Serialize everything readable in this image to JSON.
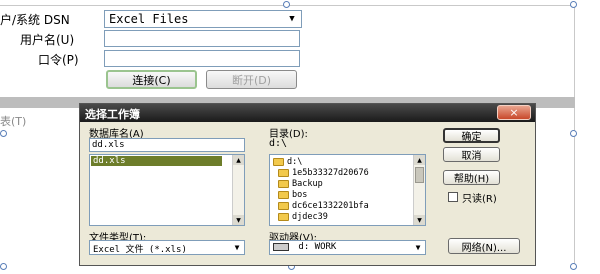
{
  "connection": {
    "dsn_label": "户/系统 DSN",
    "dsn_value": "Excel Files",
    "username_label": "用户名(U)",
    "username_value": "",
    "password_label": "口令(P)",
    "password_value": "",
    "connect_button": "连接(C)",
    "disconnect_button": "断开(D)",
    "bg_label": "表(T)"
  },
  "dialog": {
    "title": "选择工作簿",
    "close_glyph": "×",
    "db_name_label": "数据库名(A)",
    "db_name_value": "dd.xls",
    "db_files": [
      "dd.xls"
    ],
    "directory_label": "目录(D):",
    "directory_path": "d:\\",
    "directory_items": [
      {
        "name": "d:\\",
        "open": true
      },
      {
        "name": "1e5b33327d20676"
      },
      {
        "name": "Backup"
      },
      {
        "name": "bos"
      },
      {
        "name": "dc6ce1332201bfa"
      },
      {
        "name": "djdec39"
      }
    ],
    "filetype_label": "文件类型(T):",
    "filetype_value": "Excel 文件 (*.xls)",
    "drives_label": "驱动器(V):",
    "drive_value": "d: WORK",
    "ok_button": "确定",
    "cancel_button": "取消",
    "help_button": "帮助(H)",
    "readonly_label": "只读(R)",
    "network_button": "网络(N)..."
  }
}
